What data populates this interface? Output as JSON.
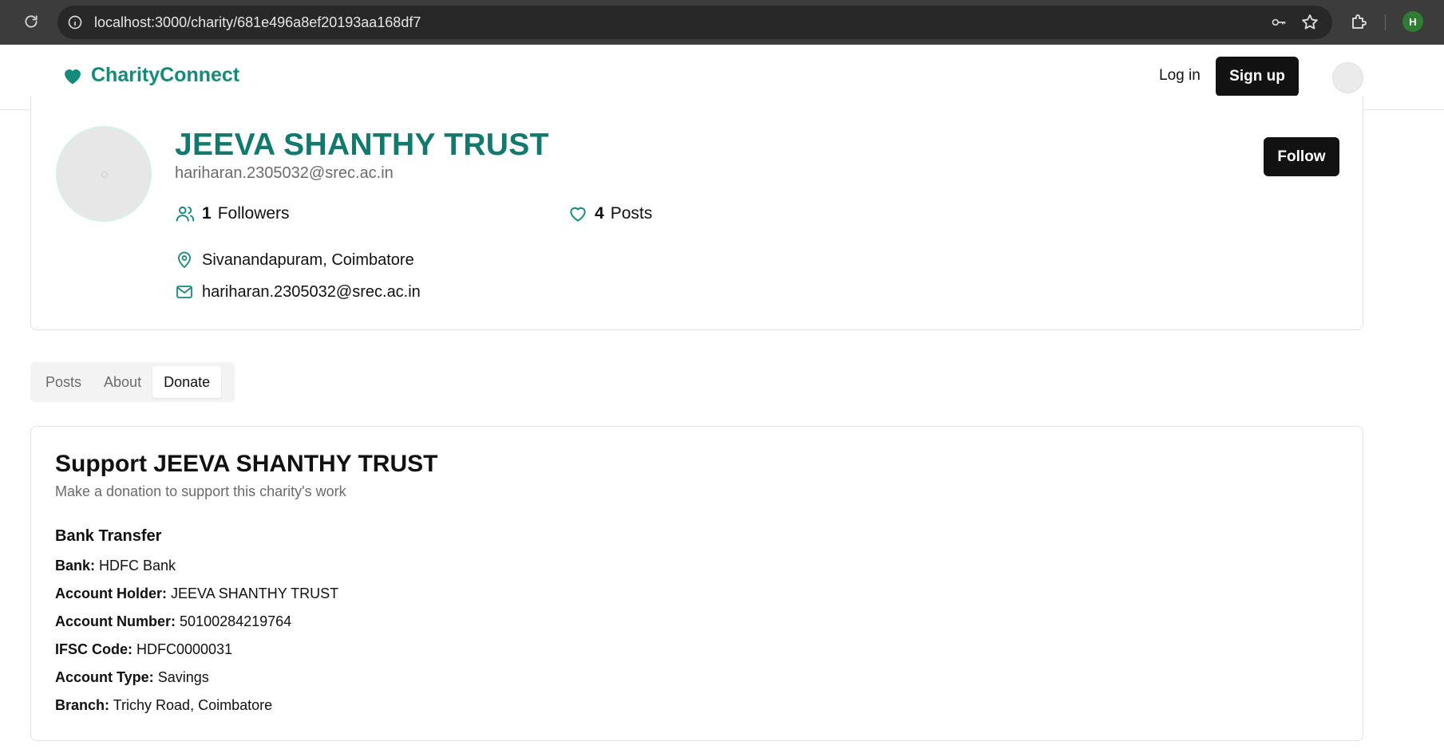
{
  "browser": {
    "url": "localhost:3000/charity/681e496a8ef20193aa168df7",
    "profile_initial": "H"
  },
  "header": {
    "brand": "CharityConnect",
    "login_label": "Log in",
    "signup_label": "Sign up"
  },
  "charity": {
    "name": "JEEVA SHANTHY TRUST",
    "email_subtitle": "hariharan.2305032@srec.ac.in",
    "followers_count": "1",
    "followers_label": "Followers",
    "posts_count": "4",
    "posts_label": "Posts",
    "location": "Sivanandapuram, Coimbatore",
    "email": "hariharan.2305032@srec.ac.in",
    "follow_label": "Follow"
  },
  "tabs": [
    {
      "label": "Posts",
      "active": false
    },
    {
      "label": "About",
      "active": false
    },
    {
      "label": "Donate",
      "active": true
    }
  ],
  "donate": {
    "title": "Support JEEVA SHANTHY TRUST",
    "subtitle": "Make a donation to support this charity's work",
    "bank_heading": "Bank Transfer",
    "rows": [
      {
        "label": "Bank:",
        "value": "HDFC Bank"
      },
      {
        "label": "Account Holder:",
        "value": "JEEVA SHANTHY TRUST"
      },
      {
        "label": "Account Number:",
        "value": "50100284219764"
      },
      {
        "label": "IFSC Code:",
        "value": "HDFC0000031"
      },
      {
        "label": "Account Type:",
        "value": "Savings"
      },
      {
        "label": "Branch:",
        "value": "Trichy Road, Coimbatore"
      }
    ]
  },
  "colors": {
    "brand": "#138a7a",
    "primary_button": "#121212"
  },
  "icons": [
    "reload-icon",
    "info-icon",
    "key-icon",
    "star-icon",
    "extensions-icon",
    "heart-icon",
    "users-icon",
    "map-pin-icon",
    "mail-icon"
  ]
}
